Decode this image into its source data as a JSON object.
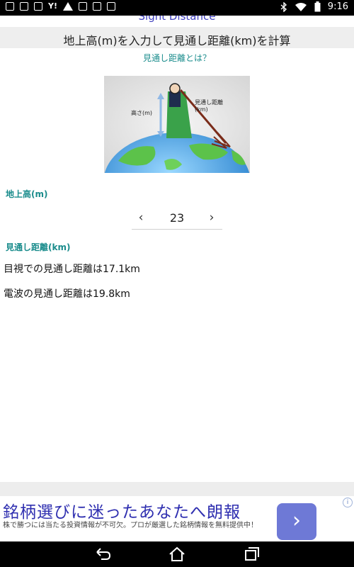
{
  "status": {
    "time": "9:16",
    "yahoo": "Y!"
  },
  "app": {
    "title": "Sight Distance",
    "heading": "地上高(m)を入力して見通し距離(km)を計算",
    "link": "見通し距離とは？"
  },
  "illustration": {
    "height_label": "高さ(m)",
    "distance_label_1": "見通し距離",
    "distance_label_2": "(km)"
  },
  "height": {
    "label": "地上高(m)",
    "value": "23",
    "dec_icon": "‹",
    "inc_icon": "›"
  },
  "distance": {
    "label": "見通し距離(km)",
    "visual": "目視での見通し距離は17.1km",
    "radio": "電波の見通し距離は19.8km"
  },
  "ad": {
    "title": "銘柄選びに迷ったあなたへ朗報",
    "subtitle": "株で勝つには当たる投資情報が不可欠。プロが厳選した銘柄情報を無料提供中！",
    "button_icon": "›",
    "info_icon": "i"
  },
  "colors": {
    "accent_teal": "#1a8c8c",
    "title_blue": "#3f3fbf",
    "ad_button": "#6e79d6"
  }
}
